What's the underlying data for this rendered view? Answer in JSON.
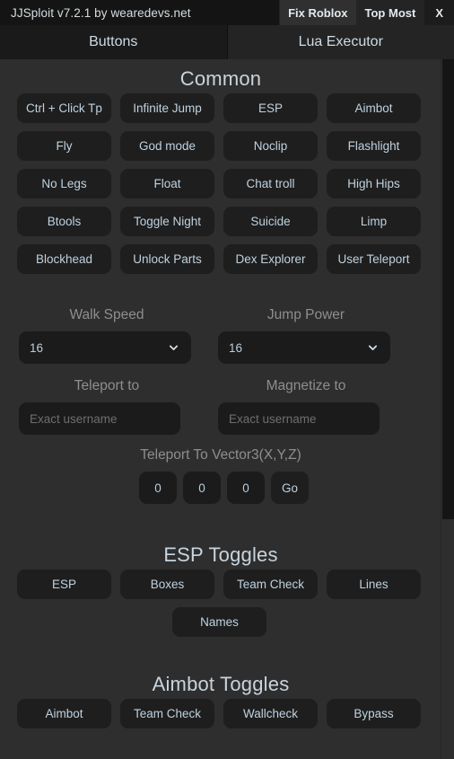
{
  "titlebar": {
    "title": "JJSploit v7.2.1 by wearedevs.net",
    "fix_roblox": "Fix Roblox",
    "top_most": "Top Most",
    "close": "X"
  },
  "tabs": [
    {
      "label": "Buttons",
      "active": true
    },
    {
      "label": "Lua Executor",
      "active": false
    }
  ],
  "common": {
    "heading": "Common",
    "buttons": [
      "Ctrl + Click Tp",
      "Infinite Jump",
      "ESP",
      "Aimbot",
      "Fly",
      "God mode",
      "Noclip",
      "Flashlight",
      "No Legs",
      "Float",
      "Chat troll",
      "High Hips",
      "Btools",
      "Toggle Night",
      "Suicide",
      "Limp",
      "Blockhead",
      "Unlock Parts",
      "Dex Explorer",
      "User Teleport"
    ]
  },
  "stats": {
    "walk_speed_label": "Walk Speed",
    "walk_speed_value": "16",
    "jump_power_label": "Jump Power",
    "jump_power_value": "16",
    "teleport_to_label": "Teleport to",
    "teleport_to_placeholder": "Exact username",
    "teleport_to_value": "",
    "magnetize_to_label": "Magnetize to",
    "magnetize_to_placeholder": "Exact username",
    "magnetize_to_value": ""
  },
  "vector3": {
    "heading": "Teleport To Vector3(X,Y,Z)",
    "x": "0",
    "y": "0",
    "z": "0",
    "go_label": "Go"
  },
  "esp": {
    "heading": "ESP Toggles",
    "buttons": [
      "ESP",
      "Boxes",
      "Team Check",
      "Lines"
    ],
    "extra_button": "Names"
  },
  "aimbot": {
    "heading": "Aimbot Toggles",
    "buttons": [
      "Aimbot",
      "Team Check",
      "Wallcheck",
      "Bypass"
    ]
  },
  "icons": {
    "chevron_down": "chevron-down-icon"
  },
  "colors": {
    "window_bg": "#2e2e2e",
    "titlebar_bg": "#141414",
    "button_bg": "#1e1e1e",
    "text": "#bfd2e0",
    "muted_text": "#8e8e8e",
    "active_tab_bg": "#1a1a1a"
  }
}
